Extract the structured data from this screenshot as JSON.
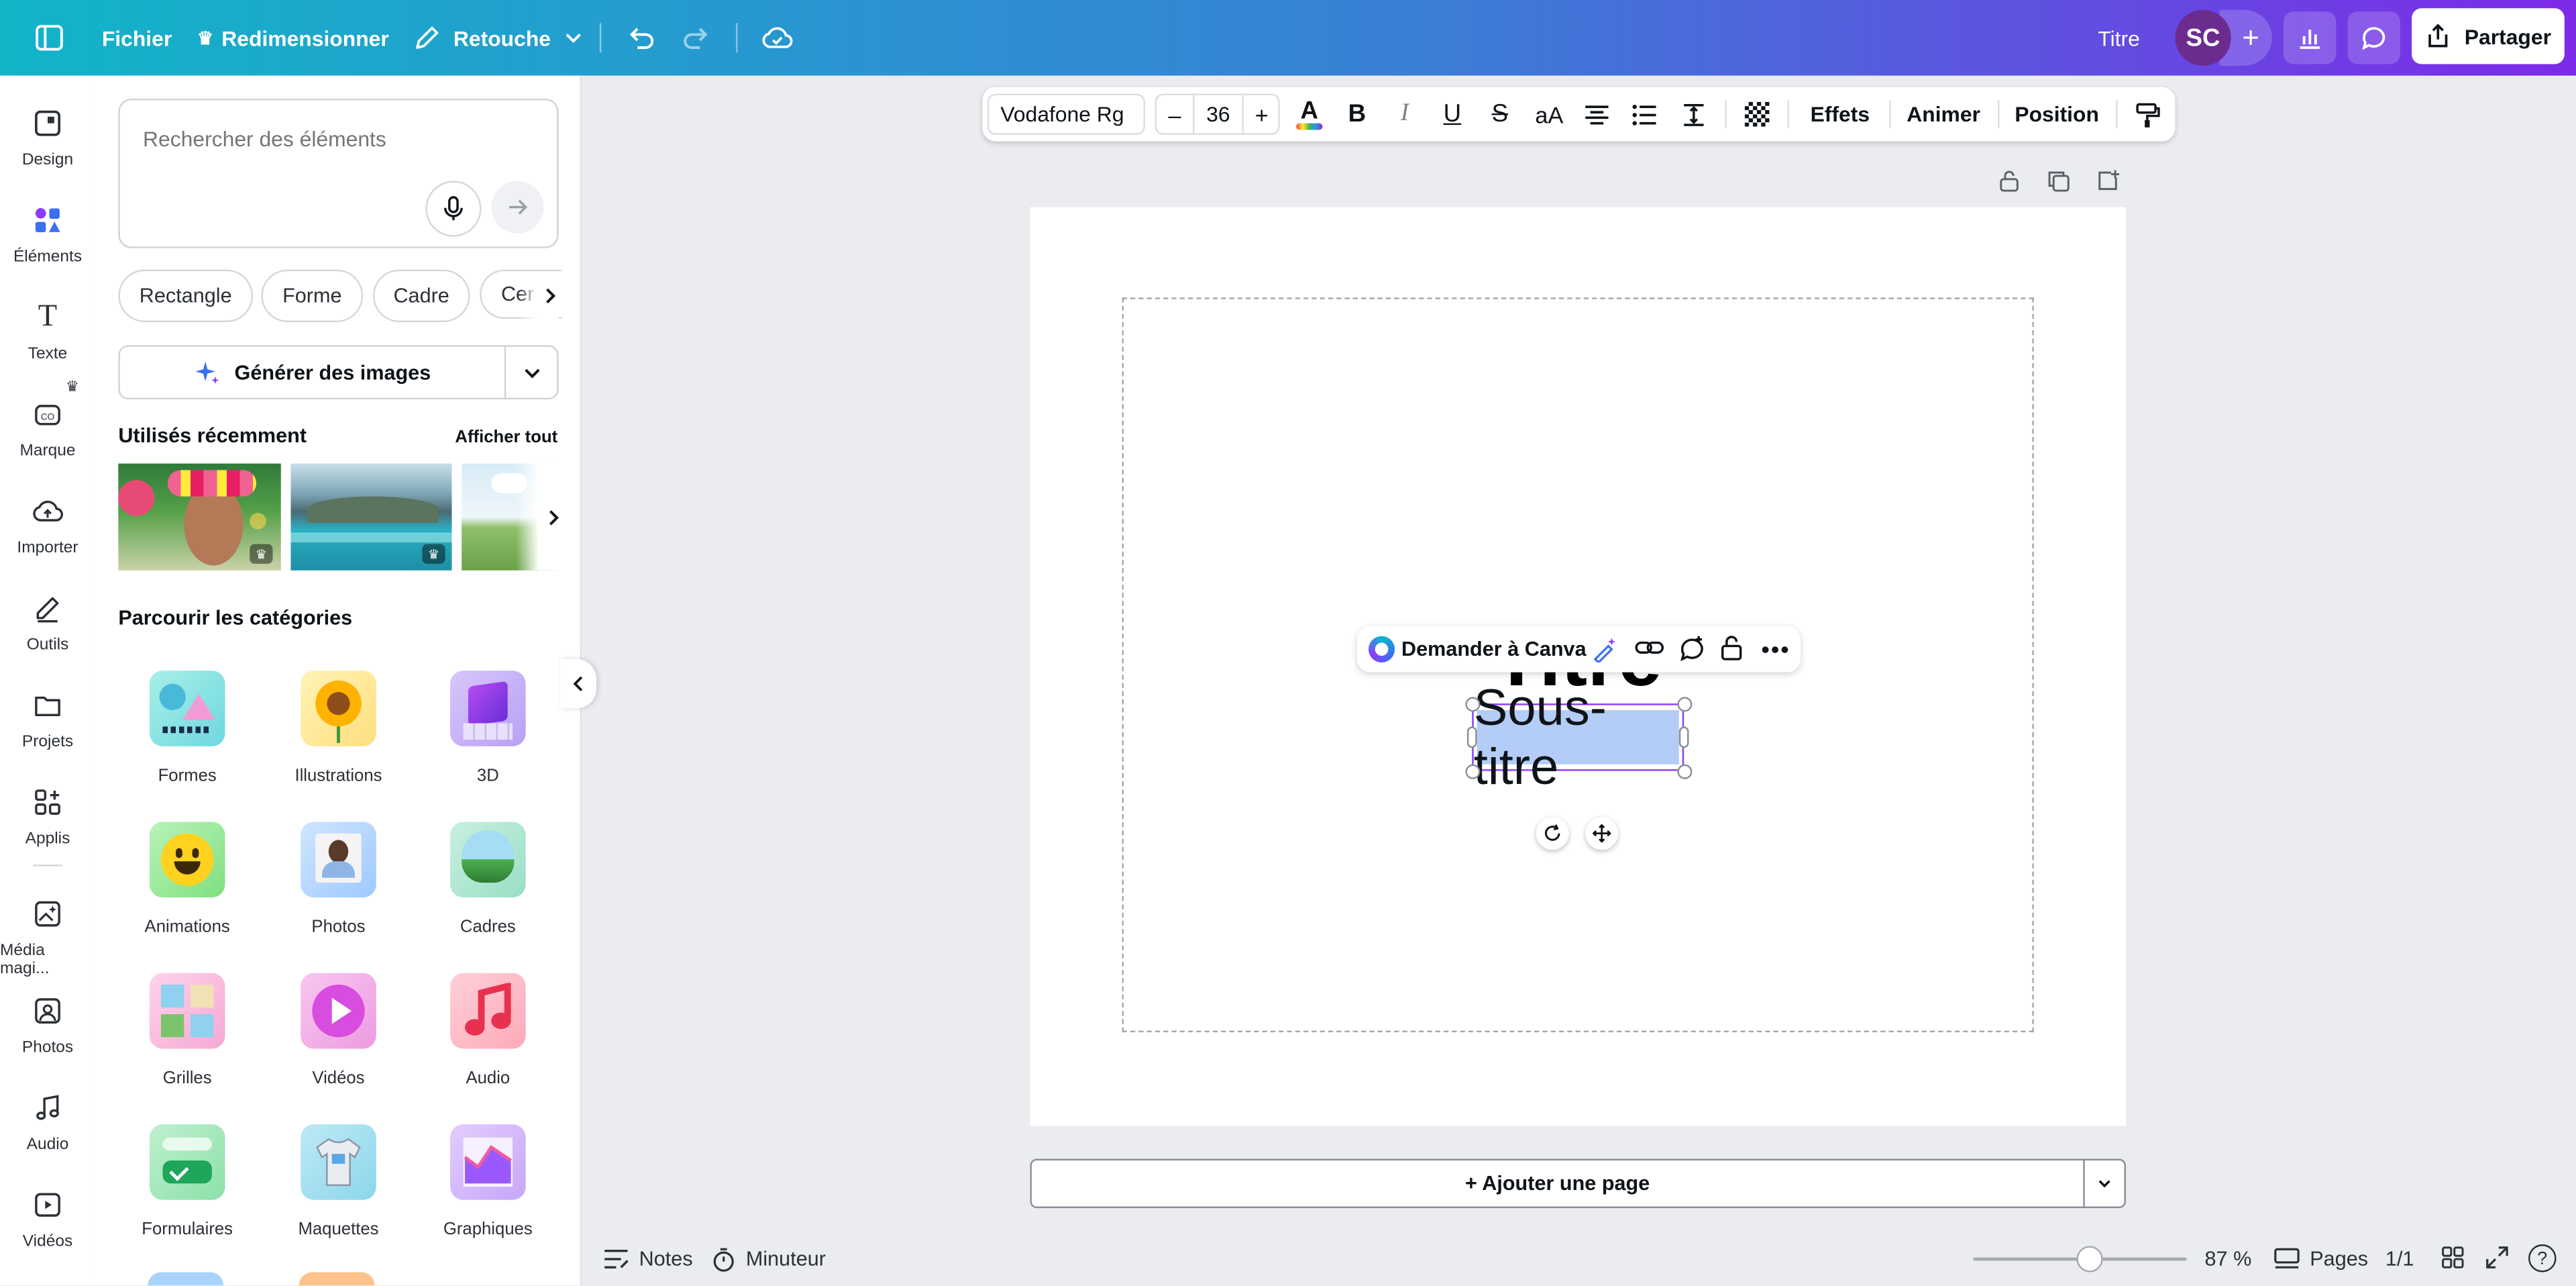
{
  "topbar": {
    "file": "Fichier",
    "resize": "Redimensionner",
    "edit": "Retouche",
    "title": "Titre",
    "avatar": "SC",
    "share": "Partager"
  },
  "rail": {
    "items": [
      {
        "label": "Design",
        "icon": "layout-icon"
      },
      {
        "label": "Éléments",
        "icon": "elements-icon"
      },
      {
        "label": "Texte",
        "icon": "text-icon"
      },
      {
        "label": "Marque",
        "icon": "brand-icon"
      },
      {
        "label": "Importer",
        "icon": "upload-cloud-icon"
      },
      {
        "label": "Outils",
        "icon": "pen-tool-icon"
      },
      {
        "label": "Projets",
        "icon": "folder-icon"
      },
      {
        "label": "Applis",
        "icon": "apps-icon"
      },
      {
        "label": "Média magi...",
        "icon": "magic-media-icon"
      },
      {
        "label": "Photos",
        "icon": "photo-icon"
      },
      {
        "label": "Audio",
        "icon": "music-icon"
      },
      {
        "label": "Vidéos",
        "icon": "video-icon"
      }
    ]
  },
  "panel": {
    "search_placeholder": "Rechercher des éléments",
    "chips": [
      "Rectangle",
      "Forme",
      "Cadre",
      "Cer"
    ],
    "generate": "Générer des images",
    "recent_title": "Utilisés récemment",
    "see_all": "Afficher tout",
    "browse_title": "Parcourir les catégories",
    "categories": [
      {
        "label": "Formes"
      },
      {
        "label": "Illustrations"
      },
      {
        "label": "3D"
      },
      {
        "label": "Animations"
      },
      {
        "label": "Photos"
      },
      {
        "label": "Cadres"
      },
      {
        "label": "Grilles"
      },
      {
        "label": "Vidéos"
      },
      {
        "label": "Audio"
      },
      {
        "label": "Formulaires"
      },
      {
        "label": "Maquettes"
      },
      {
        "label": "Graphiques"
      }
    ]
  },
  "format_bar": {
    "font": "Vodafone Rg",
    "size": "36",
    "effects": "Effets",
    "animate": "Animer",
    "position": "Position"
  },
  "canvas": {
    "title": "Titre",
    "subtitle": "Sous-titre",
    "ask_canva": "Demander à Canva",
    "add_page": "+ Ajouter une page"
  },
  "bottom": {
    "notes": "Notes",
    "timer": "Minuteur",
    "zoom": "87 %",
    "pages_label": "Pages",
    "pages_count": "1/1"
  },
  "colors": {
    "accent": "#7d2ae8",
    "selection": "#8b3dff",
    "text_highlight": "#b4cdf7"
  }
}
